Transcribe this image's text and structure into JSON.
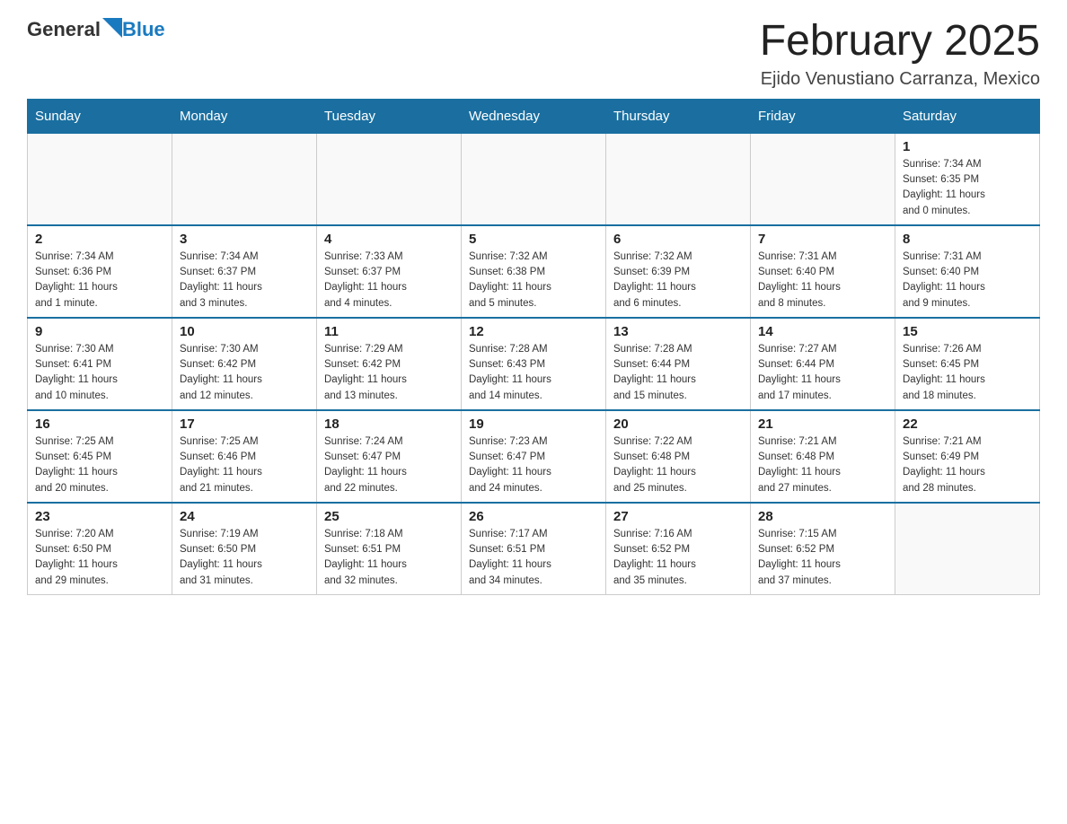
{
  "header": {
    "logo": {
      "general": "General",
      "blue": "Blue"
    },
    "title": "February 2025",
    "location": "Ejido Venustiano Carranza, Mexico"
  },
  "weekdays": [
    "Sunday",
    "Monday",
    "Tuesday",
    "Wednesday",
    "Thursday",
    "Friday",
    "Saturday"
  ],
  "weeks": [
    [
      {
        "day": "",
        "info": ""
      },
      {
        "day": "",
        "info": ""
      },
      {
        "day": "",
        "info": ""
      },
      {
        "day": "",
        "info": ""
      },
      {
        "day": "",
        "info": ""
      },
      {
        "day": "",
        "info": ""
      },
      {
        "day": "1",
        "info": "Sunrise: 7:34 AM\nSunset: 6:35 PM\nDaylight: 11 hours\nand 0 minutes."
      }
    ],
    [
      {
        "day": "2",
        "info": "Sunrise: 7:34 AM\nSunset: 6:36 PM\nDaylight: 11 hours\nand 1 minute."
      },
      {
        "day": "3",
        "info": "Sunrise: 7:34 AM\nSunset: 6:37 PM\nDaylight: 11 hours\nand 3 minutes."
      },
      {
        "day": "4",
        "info": "Sunrise: 7:33 AM\nSunset: 6:37 PM\nDaylight: 11 hours\nand 4 minutes."
      },
      {
        "day": "5",
        "info": "Sunrise: 7:32 AM\nSunset: 6:38 PM\nDaylight: 11 hours\nand 5 minutes."
      },
      {
        "day": "6",
        "info": "Sunrise: 7:32 AM\nSunset: 6:39 PM\nDaylight: 11 hours\nand 6 minutes."
      },
      {
        "day": "7",
        "info": "Sunrise: 7:31 AM\nSunset: 6:40 PM\nDaylight: 11 hours\nand 8 minutes."
      },
      {
        "day": "8",
        "info": "Sunrise: 7:31 AM\nSunset: 6:40 PM\nDaylight: 11 hours\nand 9 minutes."
      }
    ],
    [
      {
        "day": "9",
        "info": "Sunrise: 7:30 AM\nSunset: 6:41 PM\nDaylight: 11 hours\nand 10 minutes."
      },
      {
        "day": "10",
        "info": "Sunrise: 7:30 AM\nSunset: 6:42 PM\nDaylight: 11 hours\nand 12 minutes."
      },
      {
        "day": "11",
        "info": "Sunrise: 7:29 AM\nSunset: 6:42 PM\nDaylight: 11 hours\nand 13 minutes."
      },
      {
        "day": "12",
        "info": "Sunrise: 7:28 AM\nSunset: 6:43 PM\nDaylight: 11 hours\nand 14 minutes."
      },
      {
        "day": "13",
        "info": "Sunrise: 7:28 AM\nSunset: 6:44 PM\nDaylight: 11 hours\nand 15 minutes."
      },
      {
        "day": "14",
        "info": "Sunrise: 7:27 AM\nSunset: 6:44 PM\nDaylight: 11 hours\nand 17 minutes."
      },
      {
        "day": "15",
        "info": "Sunrise: 7:26 AM\nSunset: 6:45 PM\nDaylight: 11 hours\nand 18 minutes."
      }
    ],
    [
      {
        "day": "16",
        "info": "Sunrise: 7:25 AM\nSunset: 6:45 PM\nDaylight: 11 hours\nand 20 minutes."
      },
      {
        "day": "17",
        "info": "Sunrise: 7:25 AM\nSunset: 6:46 PM\nDaylight: 11 hours\nand 21 minutes."
      },
      {
        "day": "18",
        "info": "Sunrise: 7:24 AM\nSunset: 6:47 PM\nDaylight: 11 hours\nand 22 minutes."
      },
      {
        "day": "19",
        "info": "Sunrise: 7:23 AM\nSunset: 6:47 PM\nDaylight: 11 hours\nand 24 minutes."
      },
      {
        "day": "20",
        "info": "Sunrise: 7:22 AM\nSunset: 6:48 PM\nDaylight: 11 hours\nand 25 minutes."
      },
      {
        "day": "21",
        "info": "Sunrise: 7:21 AM\nSunset: 6:48 PM\nDaylight: 11 hours\nand 27 minutes."
      },
      {
        "day": "22",
        "info": "Sunrise: 7:21 AM\nSunset: 6:49 PM\nDaylight: 11 hours\nand 28 minutes."
      }
    ],
    [
      {
        "day": "23",
        "info": "Sunrise: 7:20 AM\nSunset: 6:50 PM\nDaylight: 11 hours\nand 29 minutes."
      },
      {
        "day": "24",
        "info": "Sunrise: 7:19 AM\nSunset: 6:50 PM\nDaylight: 11 hours\nand 31 minutes."
      },
      {
        "day": "25",
        "info": "Sunrise: 7:18 AM\nSunset: 6:51 PM\nDaylight: 11 hours\nand 32 minutes."
      },
      {
        "day": "26",
        "info": "Sunrise: 7:17 AM\nSunset: 6:51 PM\nDaylight: 11 hours\nand 34 minutes."
      },
      {
        "day": "27",
        "info": "Sunrise: 7:16 AM\nSunset: 6:52 PM\nDaylight: 11 hours\nand 35 minutes."
      },
      {
        "day": "28",
        "info": "Sunrise: 7:15 AM\nSunset: 6:52 PM\nDaylight: 11 hours\nand 37 minutes."
      },
      {
        "day": "",
        "info": ""
      }
    ]
  ]
}
